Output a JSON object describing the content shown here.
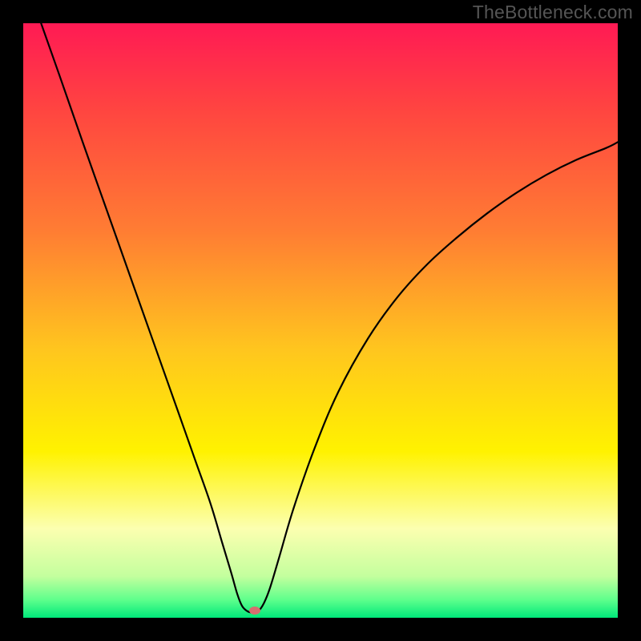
{
  "watermark": "TheBottleneck.com",
  "chart_data": {
    "type": "line",
    "title": "",
    "xlabel": "",
    "ylabel": "",
    "xlim": [
      0,
      100
    ],
    "ylim": [
      0,
      100
    ],
    "gradient_stops": [
      {
        "pct": 0.0,
        "color": "#ff1a54"
      },
      {
        "pct": 15.0,
        "color": "#ff4640"
      },
      {
        "pct": 35.0,
        "color": "#ff7d33"
      },
      {
        "pct": 55.0,
        "color": "#ffc61e"
      },
      {
        "pct": 72.0,
        "color": "#fff200"
      },
      {
        "pct": 85.0,
        "color": "#fcffb0"
      },
      {
        "pct": 93.0,
        "color": "#c4ff9e"
      },
      {
        "pct": 97.0,
        "color": "#5eff8c"
      },
      {
        "pct": 100.0,
        "color": "#00e87a"
      }
    ],
    "curve_points": [
      {
        "x": 3.0,
        "y": 100.0
      },
      {
        "x": 6.0,
        "y": 91.5
      },
      {
        "x": 10.0,
        "y": 80.0
      },
      {
        "x": 14.0,
        "y": 68.7
      },
      {
        "x": 18.0,
        "y": 57.4
      },
      {
        "x": 22.0,
        "y": 46.1
      },
      {
        "x": 26.0,
        "y": 34.8
      },
      {
        "x": 29.0,
        "y": 26.3
      },
      {
        "x": 31.5,
        "y": 19.2
      },
      {
        "x": 33.5,
        "y": 12.5
      },
      {
        "x": 35.0,
        "y": 7.5
      },
      {
        "x": 36.0,
        "y": 4.0
      },
      {
        "x": 36.8,
        "y": 2.0
      },
      {
        "x": 37.7,
        "y": 1.1
      },
      {
        "x": 38.5,
        "y": 0.9
      },
      {
        "x": 39.6,
        "y": 1.2
      },
      {
        "x": 40.5,
        "y": 2.5
      },
      {
        "x": 41.5,
        "y": 5.0
      },
      {
        "x": 43.0,
        "y": 10.0
      },
      {
        "x": 45.5,
        "y": 18.5
      },
      {
        "x": 49.0,
        "y": 28.5
      },
      {
        "x": 53.0,
        "y": 38.0
      },
      {
        "x": 58.0,
        "y": 47.0
      },
      {
        "x": 63.0,
        "y": 54.0
      },
      {
        "x": 68.0,
        "y": 59.5
      },
      {
        "x": 73.0,
        "y": 64.0
      },
      {
        "x": 78.0,
        "y": 68.0
      },
      {
        "x": 83.0,
        "y": 71.5
      },
      {
        "x": 88.0,
        "y": 74.5
      },
      {
        "x": 93.0,
        "y": 77.0
      },
      {
        "x": 98.0,
        "y": 79.0
      },
      {
        "x": 100.0,
        "y": 80.0
      }
    ],
    "marker": {
      "x": 39.0,
      "y": 1.2,
      "color": "#d66f6f"
    }
  }
}
